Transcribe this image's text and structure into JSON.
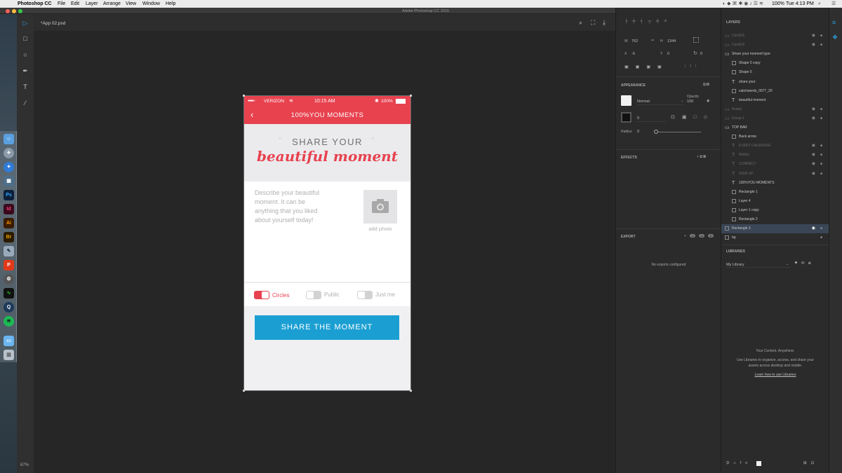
{
  "menubar": {
    "app": "Photoshop CC",
    "items": [
      "File",
      "Edit",
      "Layer",
      "Arrange",
      "View",
      "Window",
      "Help"
    ],
    "right": {
      "battery": "100%",
      "time": "Tue 4:13 PM"
    }
  },
  "window": {
    "title": "Adobe Photoshop CC 2015",
    "tab": "*App 02.psd"
  },
  "zoom": "67%",
  "dock_icons": [
    "finder-icon",
    "launchpad-icon",
    "safari-icon",
    "preview-icon",
    "photoshop-icon",
    "indesign-icon",
    "illustrator-icon",
    "bridge-icon",
    "sketchbook-icon",
    "paintbrush-icon",
    "system-prefs-icon",
    "activity-monitor-icon",
    "quicktime-icon",
    "spotify-icon",
    "folder-icon",
    "trash-icon"
  ],
  "dock_labels": {
    "ps": "Ps",
    "id": "Id",
    "ai": "Ai",
    "br": "Br"
  },
  "properties": {
    "w_label": "W",
    "w_value": "762",
    "h_label": "H",
    "h_value": "1344",
    "x_label": "X",
    "x_value": "-6",
    "y_label": "Y",
    "y_value": "0",
    "rot_value": "0"
  },
  "appearance": {
    "title": "APPEARANCE",
    "blend_mode": "Normal",
    "opacity_label": "Opacity",
    "opacity_value": "100",
    "stroke_value": "0",
    "radius_label": "Radius",
    "radius_value": "0"
  },
  "effects": {
    "title": "EFFECTS"
  },
  "export": {
    "title": "EXPORT",
    "empty": "No exports configured",
    "tags": [
      "1x",
      "2x",
      "3x"
    ]
  },
  "layers": {
    "title": "LAYERS",
    "items": [
      {
        "name": "CardGS",
        "dim": true,
        "indent": 0,
        "type": "folder"
      },
      {
        "name": "CardGS",
        "dim": true,
        "indent": 0,
        "type": "folder"
      },
      {
        "name": "Share your moment type",
        "dim": false,
        "indent": 0,
        "type": "folder"
      },
      {
        "name": "Shape 5 copy",
        "dim": false,
        "indent": 1,
        "type": "shape"
      },
      {
        "name": "Shape 5",
        "dim": false,
        "indent": 1,
        "type": "shape"
      },
      {
        "name": "share your",
        "dim": false,
        "indent": 1,
        "type": "text"
      },
      {
        "name": "catchwords_0077_20",
        "dim": false,
        "indent": 1,
        "type": "image"
      },
      {
        "name": "beautiful moment",
        "dim": false,
        "indent": 1,
        "type": "text"
      },
      {
        "name": "Avatar",
        "dim": true,
        "indent": 0,
        "type": "folder"
      },
      {
        "name": "Group 1",
        "dim": true,
        "indent": 0,
        "type": "folder"
      },
      {
        "name": "TOP BAR",
        "dim": false,
        "indent": 0,
        "type": "folder"
      },
      {
        "name": "Back arrow",
        "dim": false,
        "indent": 1,
        "type": "shape"
      },
      {
        "name": "EVENT CALENDAR",
        "dim": true,
        "indent": 1,
        "type": "text"
      },
      {
        "name": "Welkin",
        "dim": true,
        "indent": 1,
        "type": "text"
      },
      {
        "name": "CONNECT",
        "dim": true,
        "indent": 1,
        "type": "text"
      },
      {
        "name": "SIGN UP",
        "dim": true,
        "indent": 1,
        "type": "text"
      },
      {
        "name": "100%YOU MOMENTS",
        "dim": false,
        "indent": 1,
        "type": "text"
      },
      {
        "name": "Rectangle 1",
        "dim": false,
        "indent": 1,
        "type": "shape"
      },
      {
        "name": "Layer 4",
        "dim": false,
        "indent": 1,
        "type": "image"
      },
      {
        "name": "Layer 1 copy",
        "dim": false,
        "indent": 1,
        "type": "image"
      },
      {
        "name": "Rectangle 2",
        "dim": false,
        "indent": 1,
        "type": "shape"
      },
      {
        "name": "Rectangle 3",
        "dim": false,
        "indent": 0,
        "type": "shape",
        "selected": true
      },
      {
        "name": "bg",
        "dim": false,
        "indent": 0,
        "type": "shape"
      }
    ]
  },
  "libraries": {
    "title": "LIBRARIES",
    "selected": "My Library",
    "headline": "Your Content. Anywhere.",
    "body_line1": "Use Libraries to organize, access, and share your",
    "body_line2": "assets across desktop and mobile.",
    "link": "Learn how to use Libraries"
  },
  "phone": {
    "carrier": "VERIZON",
    "time": "10:15 AM",
    "battery": "100%",
    "nav_title": "100%YOU MOMENTS",
    "hero_line1": "SHARE YOUR",
    "hero_line2": "beautiful moment",
    "description": [
      "Describe your beautiful",
      "moment. It can be",
      "anything that you liked",
      "about yourself today!"
    ],
    "add_photo": "add photo",
    "toggles": [
      {
        "label": "Circles",
        "on": true
      },
      {
        "label": "Public",
        "on": false
      },
      {
        "label": "Just me",
        "on": false
      }
    ],
    "share_button": "SHARE THE MOMENT"
  },
  "colors": {
    "accent": "#e8424f",
    "button": "#1b9fd3",
    "selection": "#3a4656"
  }
}
